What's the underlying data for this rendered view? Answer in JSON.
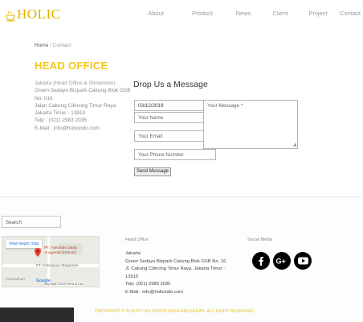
{
  "brand": {
    "name": "HOLIC",
    "color": "#e0b400",
    "logo_icon": "cup-icon"
  },
  "nav": {
    "items": [
      "About",
      "Product",
      "News",
      "Client",
      "Project",
      "Contact"
    ]
  },
  "breadcrumb": {
    "home": "Home",
    "separator": "/",
    "current": "Contact"
  },
  "head_office": {
    "title": "HEAD OFFICE",
    "place": "Jakarta (Head Office & Showroom)",
    "lines": [
      "Green Sedayu Bizpark Cakung Blok GSB No. 016",
      "Jalan Cakung Cilincing Timur Raya",
      "Jakarta Timur - 13910"
    ],
    "telp": "Telp    : (021) 2983 2035",
    "email": "E-Mail  : info@holicindo.com",
    "accent": "#f2c811"
  },
  "form": {
    "title": "Drop Us a Message",
    "date_value": "03/12/2019",
    "name_placeholder": "Your Name",
    "email_placeholder": "Your Email",
    "phone_placeholder": "Your Phone Number",
    "message_placeholder": "Your Message *",
    "send_label": "Send Message"
  },
  "footer": {
    "search_placeholder": "Search",
    "map": {
      "view_larger": "View larger map",
      "place_label": "PT. Holicindo Dasa Anugerah (HOLIC)",
      "poi": "PT Ambarjaya Megamas",
      "poi2": "Perumahan",
      "google": "Google",
      "map_data": "Map data ©2019   Terms of Use"
    },
    "head_office_label": "Head Office",
    "address": [
      "Jakarta",
      "Green Sedayu Bizpark Cakung Blok GSB No. 16",
      "Jl. Cakung Cilincing Timur Raya, Jakarta Timur - 13910",
      "Telp     :(021) 2983 2035",
      "E-Mail   : info@holicindo.com"
    ],
    "social_label": "Social Media",
    "social": [
      "facebook-icon",
      "google-plus-icon",
      "youtube-icon"
    ],
    "copyright": "COPYRIGHT © 2016 PT HOLICINDO DASA ANUGERAH. ALL RIGHT RESERVED."
  }
}
